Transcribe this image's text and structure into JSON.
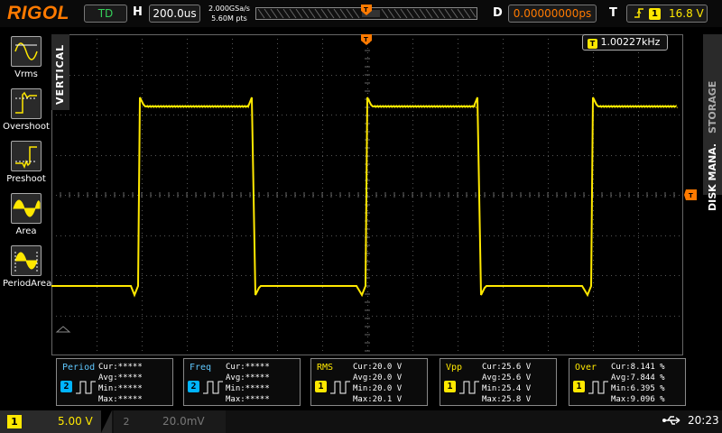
{
  "header": {
    "brand": "RIGOL",
    "run_status": "TD",
    "h_label": "H",
    "timebase": "200.0us",
    "sample_rate": "2.000GSa/s",
    "memory_depth": "5.60M pts",
    "d_label": "D",
    "trigger_delay": "0.00000000ps",
    "t_label": "T",
    "trigger_level": "16.8 V"
  },
  "left_panel": {
    "tab_label": "VERTICAL",
    "items": [
      {
        "label": "Vrms",
        "icon": "vrms-icon"
      },
      {
        "label": "Overshoot",
        "icon": "overshoot-icon"
      },
      {
        "label": "Preshoot",
        "icon": "preshoot-icon"
      },
      {
        "label": "Area",
        "icon": "area-icon"
      },
      {
        "label": "PeriodArea",
        "icon": "period-area-icon"
      }
    ]
  },
  "right_panel": {
    "tab_label": "DISK MANA.",
    "tab_label_2": "STORAGE"
  },
  "display": {
    "frequency_counter": "1.00227kHz",
    "trace_color": "#ffe800"
  },
  "measurements": [
    {
      "name": "Period",
      "channel": "2",
      "channel_color": "#00b4ff",
      "name_color": "#5fc8ff",
      "cur": "Cur:*****",
      "avg": "Avg:*****",
      "min": "Min:*****",
      "max": "Max:*****"
    },
    {
      "name": "Freq",
      "channel": "2",
      "channel_color": "#00b4ff",
      "name_color": "#5fc8ff",
      "cur": "Cur:*****",
      "avg": "Avg:*****",
      "min": "Min:*****",
      "max": "Max:*****"
    },
    {
      "name": "RMS",
      "channel": "1",
      "channel_color": "#ffe800",
      "name_color": "#ffe800",
      "cur": "Cur:20.0 V",
      "avg": "Avg:20.0 V",
      "min": "Min:20.0 V",
      "max": "Max:20.1 V"
    },
    {
      "name": "Vpp",
      "channel": "1",
      "channel_color": "#ffe800",
      "name_color": "#ffe800",
      "cur": "Cur:25.6 V",
      "avg": "Avg:25.6 V",
      "min": "Min:25.4 V",
      "max": "Max:25.8 V"
    },
    {
      "name": "Over",
      "channel": "1",
      "channel_color": "#ffe800",
      "name_color": "#ffe800",
      "cur": "Cur:8.141 %",
      "avg": "Avg:7.844 %",
      "min": "Min:6.395 %",
      "max": "Max:9.096 %"
    }
  ],
  "bottom_bar": {
    "ch1_number": "1",
    "ch1_scale": "5.00 V",
    "ch2_number": "2",
    "ch2_scale": "20.0mV",
    "usb_icon": "usb-icon",
    "clock": "20:23"
  }
}
